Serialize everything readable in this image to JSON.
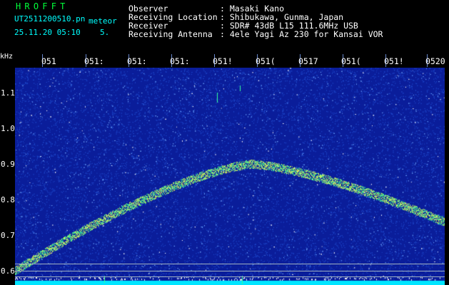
{
  "header": {
    "app_title": "HROFFT",
    "filename": "UT2511200510.pn",
    "tag": "meteor",
    "datetime": "25.11.20 05:10",
    "page": "5.",
    "meta": [
      {
        "label": "Observer",
        "value": ": Masaki Kano"
      },
      {
        "label": "Receiving Location",
        "value": ": Shibukawa, Gunma, Japan"
      },
      {
        "label": "Receiver",
        "value": ": SDR# 43dB L15 111.6MHz USB"
      },
      {
        "label": "Receiving Antenna",
        "value": ": 4ele Yagi Az 230 for Kansai VOR"
      }
    ]
  },
  "axis": {
    "unit": "kHz",
    "x_ticks": [
      "051",
      "051:",
      "051:",
      "051:",
      "051!",
      "051(",
      "0517",
      "051(",
      "051!",
      "0520"
    ],
    "y_ticks": [
      "1.1",
      "1.0",
      "0.9",
      "0.8",
      "0.7",
      "0.6"
    ]
  },
  "colors": {
    "background": "#0a1d9a",
    "noise_low": "#1e46c8",
    "noise_high": "#6ea6ff",
    "trail": "#33ff99",
    "carrier": "#00e5ff",
    "text_header": "#ffffff",
    "text_title": "#00ff3a",
    "text_cyan": "#00ffff"
  }
}
